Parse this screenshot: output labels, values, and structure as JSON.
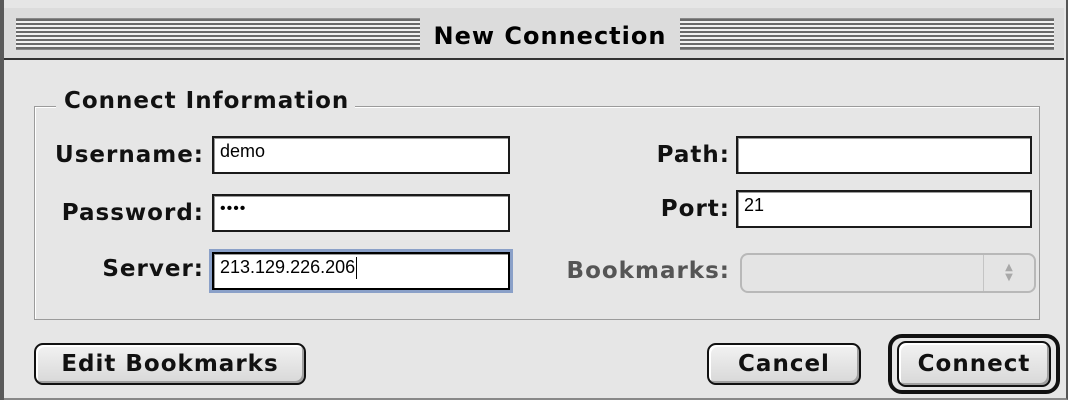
{
  "window": {
    "title": "New Connection"
  },
  "group": {
    "title": "Connect Information"
  },
  "fields": {
    "username": {
      "label": "Username:",
      "value": "demo"
    },
    "password": {
      "label": "Password:",
      "value": "••••"
    },
    "server": {
      "label": "Server:",
      "value": "213.129.226.206"
    },
    "path": {
      "label": "Path:",
      "value": ""
    },
    "port": {
      "label": "Port:",
      "value": "21"
    },
    "bookmarks": {
      "label": "Bookmarks:",
      "value": ""
    }
  },
  "buttons": {
    "edit_bookmarks": "Edit Bookmarks",
    "cancel": "Cancel",
    "connect": "Connect"
  },
  "icons": {
    "popup_arrows": "up-down-arrows-icon"
  },
  "colors": {
    "window_bg": "#e6e6e6",
    "focus_ring": "#8aa0c8"
  }
}
